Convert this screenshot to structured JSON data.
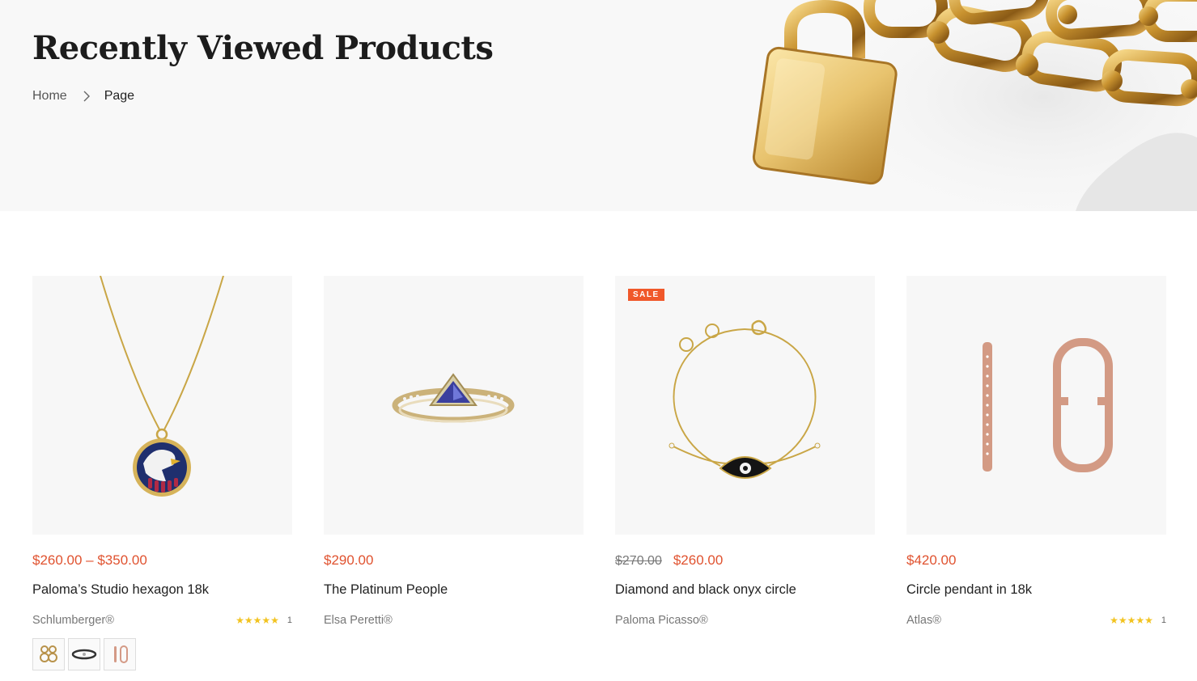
{
  "header": {
    "title": "Recently Viewed Products",
    "breadcrumb": {
      "home": "Home",
      "current": "Page"
    }
  },
  "colors": {
    "price": "#e0522f",
    "sale_badge": "#f0582a",
    "star": "#f2c320",
    "hero_bg": "#f8f8f8"
  },
  "products": [
    {
      "price": "$260.00 – $350.00",
      "old_price": "",
      "title": "Paloma’s Studio hexagon 18k",
      "brand": "Schlumberger®",
      "stars": "★★★★★",
      "rating_count": "1",
      "image_icon": "eagle-pendant-necklace",
      "swatches": [
        "earrings-swatch",
        "ring-swatch",
        "hoop-swatch"
      ]
    },
    {
      "price": "$290.00",
      "old_price": "",
      "title": "The Platinum People",
      "brand": "Elsa Peretti®",
      "image_icon": "tanzanite-ring"
    },
    {
      "badge": "SALE",
      "old_price": "$270.00",
      "price": "$260.00",
      "title": "Diamond and black onyx circle",
      "brand": "Paloma Picasso®",
      "image_icon": "evil-eye-bracelet"
    },
    {
      "price": "$420.00",
      "old_price": "",
      "title": "Circle pendant in 18k",
      "brand": "Atlas®",
      "stars": "★★★★★",
      "rating_count": "1",
      "image_icon": "rose-gold-hoop-earrings"
    }
  ]
}
